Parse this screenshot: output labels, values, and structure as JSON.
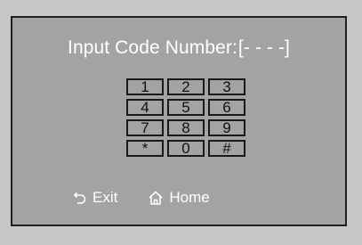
{
  "title": {
    "label": "Input Code Number:",
    "code": "[- - - -]"
  },
  "keypad": {
    "keys": [
      "1",
      "2",
      "3",
      "4",
      "5",
      "6",
      "7",
      "8",
      "9",
      "*",
      "0",
      "#"
    ]
  },
  "footer": {
    "exit_label": "Exit",
    "home_label": "Home",
    "exit_icon": "back-arrow-icon",
    "home_icon": "home-icon"
  },
  "colors": {
    "screen_background": "#a3a3a3",
    "outer_background": "#c6c6c6",
    "text": "#ffffff",
    "key_border": "#1a1a1a"
  }
}
